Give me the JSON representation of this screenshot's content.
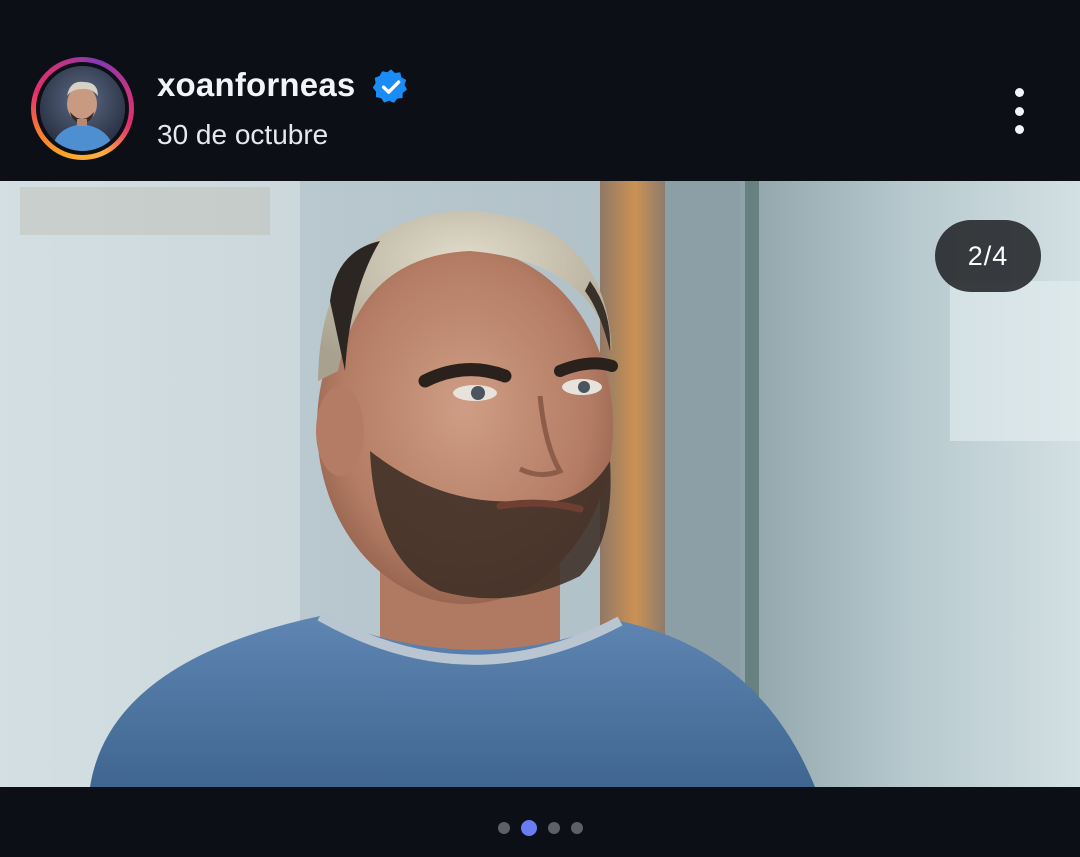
{
  "post": {
    "username": "xoanforneas",
    "verified": true,
    "date": "30 de octubre",
    "media_counter": "2/4",
    "carousel": {
      "total": 4,
      "current": 2
    }
  },
  "icons": {
    "verified": "verified-badge-icon",
    "more": "more-vertical-icon"
  },
  "colors": {
    "background": "#0c0f16",
    "verified_blue": "#1a8cf5",
    "active_dot": "#6a7cf4",
    "inactive_dot": "#5d6069"
  }
}
